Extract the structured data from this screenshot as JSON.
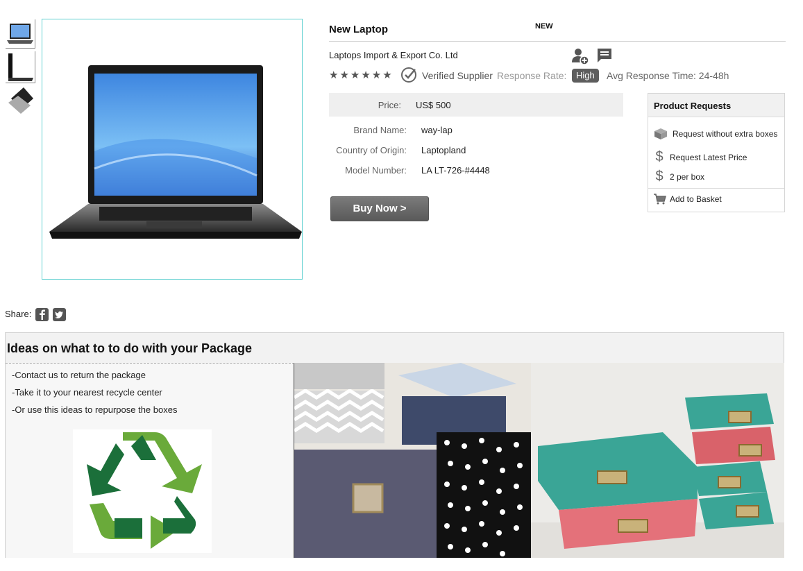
{
  "product": {
    "title": "New Laptop",
    "badge": "NEW",
    "thumbnails": [
      "laptop-front-icon",
      "laptop-side-icon",
      "laptop-angle-icon"
    ]
  },
  "supplier": {
    "name": "Laptops Import & Export Co. Ltd",
    "stars": "★★★★★★",
    "verified_label": "Verified Supplier",
    "response_rate_label": "Response Rate:",
    "response_rate_value": "High",
    "avg_response": "Avg Response Time: 24-48h"
  },
  "pricing": {
    "price_label": "Price:",
    "price_value": "US$ 500"
  },
  "specs": [
    {
      "label": "Brand Name:",
      "value": "way-lap"
    },
    {
      "label": "Country of Origin:",
      "value": "Laptopland"
    },
    {
      "label": "Model Number:",
      "value": "LA LT-726-#4448"
    }
  ],
  "buy_button": "Buy Now >",
  "requests": {
    "title": "Product Requests",
    "items": [
      {
        "icon": "box-icon",
        "label": "Request without extra boxes"
      },
      {
        "icon": "dollar-icon",
        "label": "Request Latest Price"
      },
      {
        "icon": "dollar-icon",
        "label": "2  per box"
      }
    ],
    "add_basket": "Add to Basket"
  },
  "share": {
    "label": "Share:",
    "icons": [
      "facebook-icon",
      "twitter-icon"
    ]
  },
  "ideas": {
    "title": "Ideas on what to to do with your Package",
    "lines": [
      "-Contact us to return the package",
      "-Take it to your nearest recycle center",
      "-Or use this ideas to repurpose the boxes"
    ]
  },
  "colors": {
    "image_border": "#5fd0d0",
    "button_bg": "#5a5a5a",
    "recycle_dark": "#1b6f3a",
    "recycle_light": "#6aaa3a"
  }
}
